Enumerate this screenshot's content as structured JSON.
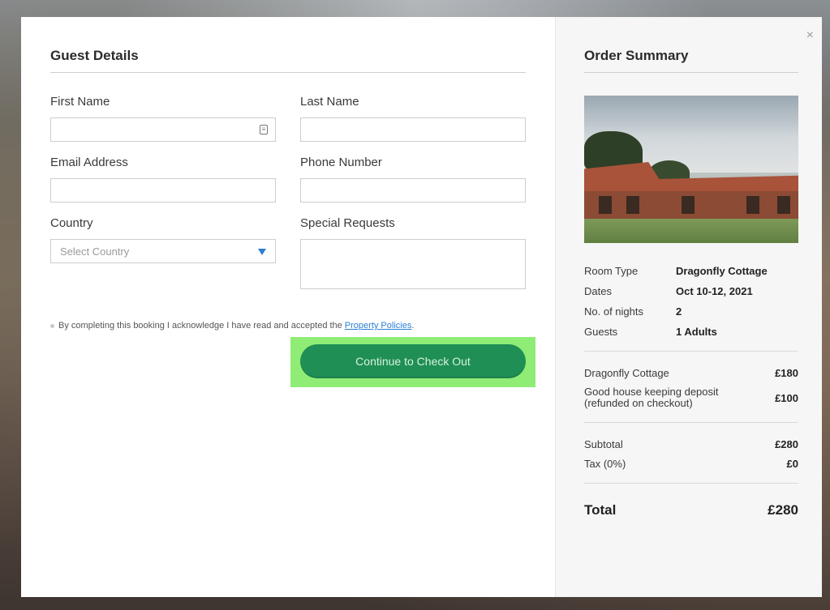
{
  "guest_details": {
    "title": "Guest Details",
    "first_name_label": "First Name",
    "last_name_label": "Last Name",
    "email_label": "Email Address",
    "phone_label": "Phone Number",
    "country_label": "Country",
    "country_placeholder": "Select Country",
    "special_requests_label": "Special Requests",
    "first_name_value": "",
    "last_name_value": "",
    "email_value": "",
    "phone_value": "",
    "special_requests_value": ""
  },
  "policy": {
    "text": "By completing this booking I acknowledge I have read and accepted the",
    "link_text": "Property Policies",
    "suffix": "."
  },
  "cta": {
    "label": "Continue to Check Out"
  },
  "close_label": "×",
  "order_summary": {
    "title": "Order Summary",
    "room_type_label": "Room Type",
    "room_type_value": "Dragonfly Cottage",
    "dates_label": "Dates",
    "dates_value": "Oct 10-12, 2021",
    "nights_label": "No. of nights",
    "nights_value": "2",
    "guests_label": "Guests",
    "guests_value": "1 Adults",
    "items": [
      {
        "label": "Dragonfly Cottage",
        "price": "£180"
      },
      {
        "label_line1": "Good house keeping deposit",
        "label_line2": "(refunded on checkout)",
        "price": "£100"
      }
    ],
    "subtotal_label": "Subtotal",
    "subtotal_value": "£280",
    "tax_label": "Tax (0%)",
    "tax_value": "£0",
    "total_label": "Total",
    "total_value": "£280"
  },
  "colors": {
    "cta_bg": "#1f8f55",
    "cta_highlight": "#8fec75",
    "link": "#2b7fd4",
    "select_caret": "#2e7fd0"
  }
}
